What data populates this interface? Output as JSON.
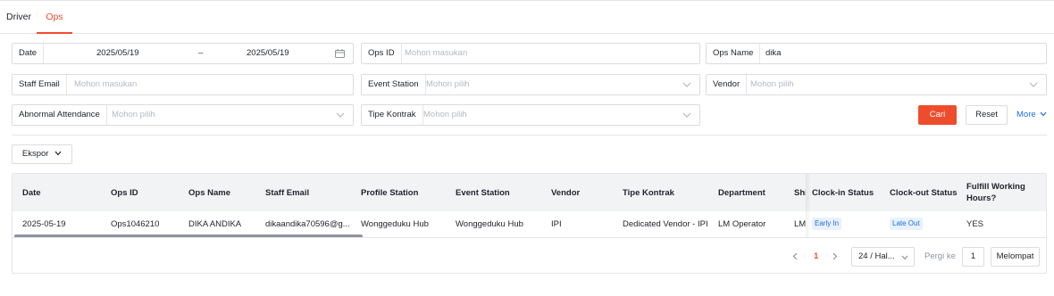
{
  "tabs": [
    {
      "label": "Driver",
      "active": false
    },
    {
      "label": "Ops",
      "active": true
    }
  ],
  "filters": {
    "date": {
      "label": "Date",
      "start": "2025/05/19",
      "separator": "–",
      "end": "2025/05/19"
    },
    "ops_id": {
      "label": "Ops ID",
      "placeholder": "Mohon masukan"
    },
    "ops_name": {
      "label": "Ops Name",
      "value": "dika"
    },
    "staff_email": {
      "label": "Staff Email",
      "placeholder": "Mohon masukan"
    },
    "event_station": {
      "label": "Event Station",
      "placeholder": "Mohon pilih"
    },
    "vendor": {
      "label": "Vendor",
      "placeholder": "Mohon pilih"
    },
    "abnormal_attendance": {
      "label": "Abnormal Attendance",
      "placeholder": "Mohon pilih"
    },
    "tipe_kontrak": {
      "label": "Tipe Kontrak",
      "placeholder": "Mohon pilih"
    }
  },
  "actions": {
    "search": "Cari",
    "reset": "Reset",
    "more": "More",
    "export": "Ekspor"
  },
  "table": {
    "columns": [
      "Date",
      "Ops ID",
      "Ops Name",
      "Staff Email",
      "Profile Station",
      "Event Station",
      "Vendor",
      "Tipe Kontrak",
      "Department",
      "Shi",
      "Clock-in Status",
      "Clock-out Status",
      "Fulfill Working Hours?"
    ],
    "rows": [
      {
        "date": "2025-05-19",
        "ops_id": "Ops1046210",
        "ops_name": "DIKA ANDIKA",
        "staff_email": "dikaandika70596@g...",
        "profile_station": "Wonggeduku Hub",
        "event_station": "Wonggeduku Hub",
        "vendor": "IPI",
        "tipe_kontrak": "Dedicated Vendor - IPI",
        "department": "LM Operator",
        "shift": "LM",
        "clock_in": "Early In",
        "clock_out": "Late Out",
        "fulfill": "YES"
      }
    ]
  },
  "pagination": {
    "current_page": "1",
    "page_size": "24 / Hal...",
    "goto_label": "Pergi ke",
    "goto_value": "1",
    "jump": "Melompat"
  },
  "colors": {
    "accent": "#ee4d2d",
    "link": "#1f6fe0",
    "badge_bg": "#e8f1fd"
  }
}
